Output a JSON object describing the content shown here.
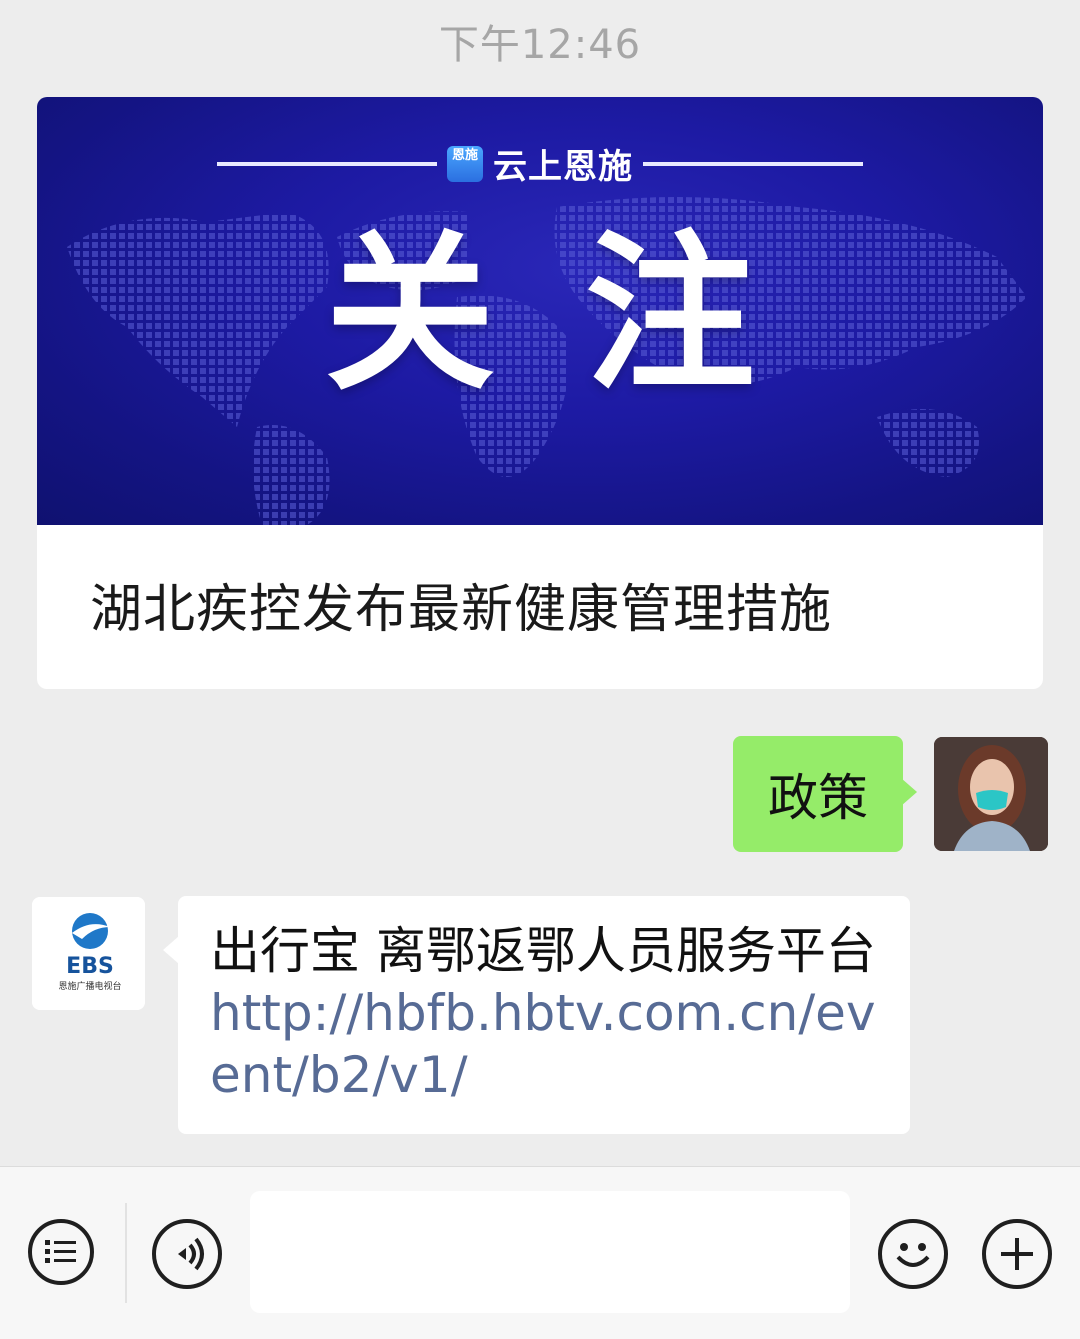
{
  "timestamp": "下午12:46",
  "article": {
    "brand_logo_text": "恩施",
    "brand_name": "云上恩施",
    "banner_title": "关注",
    "title": "湖北疾控发布最新健康管理措施"
  },
  "messages": {
    "sent_text": "政策",
    "received_text": "出行宝 离鄂返鄂人员服务平台 ",
    "received_link": "http://hbfb.hbtv.com.cn/event/b2/v1/",
    "ebs_logo_text": "EBS",
    "ebs_subtitle": "恩施广播电视台"
  },
  "toolbar": {
    "input_value": ""
  },
  "colors": {
    "background": "#ededed",
    "banner": "#1d1aa3",
    "sent_bubble": "#95ec69",
    "link": "#576b95"
  }
}
